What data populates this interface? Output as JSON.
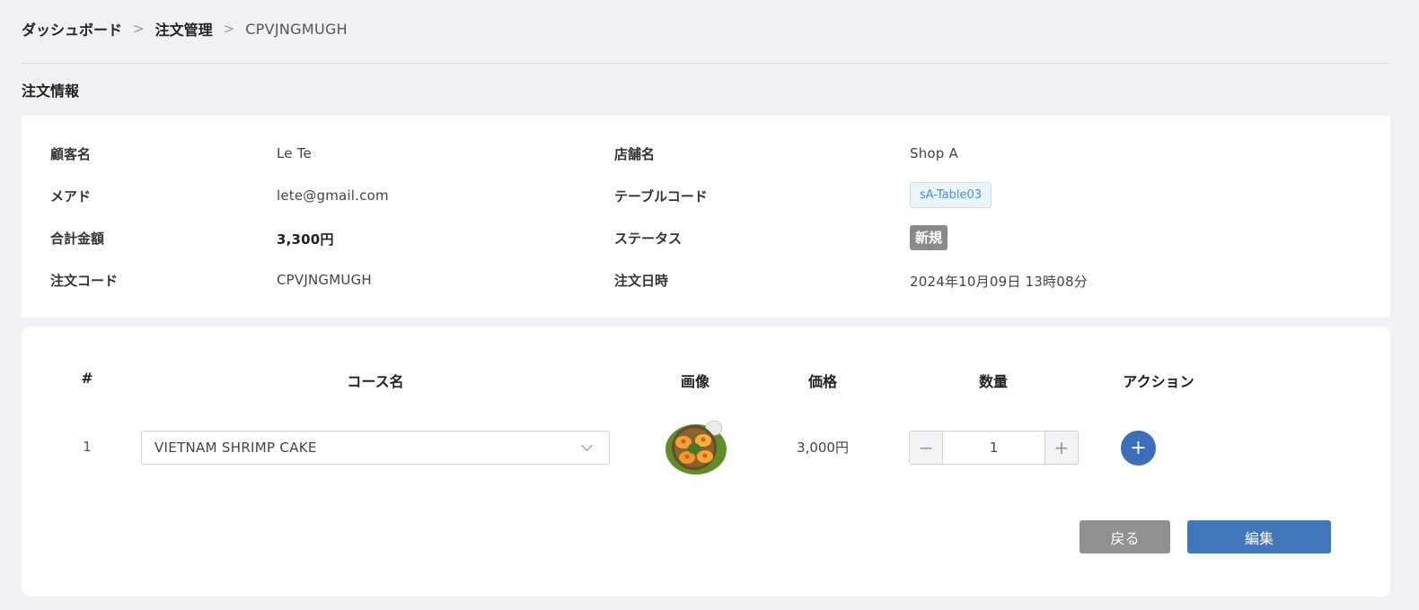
{
  "breadcrumb": {
    "items": [
      "ダッシュボード",
      "注文管理"
    ],
    "current": "CPVJNGMUGH",
    "separator": ">"
  },
  "section_title": "注文情報",
  "order_info": {
    "customer_name_label": "顧客名",
    "customer_name": "Le Te",
    "shop_name_label": "店舗名",
    "shop_name": "Shop A",
    "email_label": "メアド",
    "email": "lete@gmail.com",
    "table_code_label": "テーブルコード",
    "table_code": "sA-Table03",
    "total_label": "合計金額",
    "total": "3,300円",
    "status_label": "ステータス",
    "status": "新規",
    "order_code_label": "注文コード",
    "order_code": "CPVJNGMUGH",
    "order_datetime_label": "注文日時",
    "order_datetime": "2024年10月09日 13時08分"
  },
  "items_table": {
    "headers": [
      "#",
      "コース名",
      "画像",
      "価格",
      "数量",
      "アクション"
    ],
    "rows": [
      {
        "num": "1",
        "course": "VIETNAM SHRIMP CAKE",
        "image_icon": "shrimp-cake-photo",
        "price": "3,000円",
        "quantity": "1"
      }
    ]
  },
  "stepper": {
    "minus": "−",
    "plus": "+"
  },
  "add_button_label": "+",
  "buttons": {
    "back": "戻る",
    "edit": "編集"
  },
  "colors": {
    "primary": "#4375ba",
    "add_button": "#3b6fbb",
    "back_button": "#8f9191",
    "status_badge": "#8a8a8a",
    "table_code_bg": "#eaf4fd",
    "table_code_text": "#4a8fce",
    "page_bg": "#f0f0f5"
  }
}
